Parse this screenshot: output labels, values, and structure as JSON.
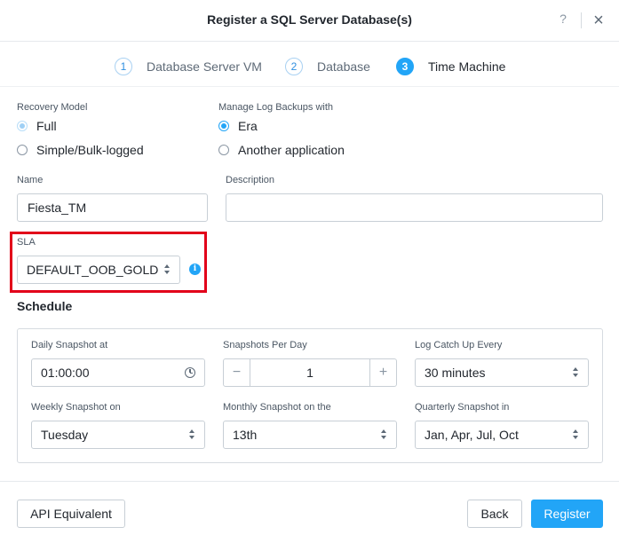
{
  "dialog": {
    "title": "Register a SQL Server Database(s)",
    "help": "?",
    "close": "×"
  },
  "steps": [
    {
      "num": "1",
      "label": "Database Server VM",
      "active": false
    },
    {
      "num": "2",
      "label": "Database",
      "active": false
    },
    {
      "num": "3",
      "label": "Time Machine",
      "active": true
    }
  ],
  "recovery": {
    "label": "Recovery Model",
    "options": [
      {
        "label": "Full",
        "checked": true
      },
      {
        "label": "Simple/Bulk-logged",
        "checked": false
      }
    ]
  },
  "log_backups": {
    "label": "Manage Log Backups with",
    "options": [
      {
        "label": "Era",
        "checked": true
      },
      {
        "label": "Another application",
        "checked": false
      }
    ]
  },
  "name": {
    "label": "Name",
    "value": "Fiesta_TM"
  },
  "description": {
    "label": "Description",
    "value": ""
  },
  "sla": {
    "label": "SLA",
    "value": "DEFAULT_OOB_GOLD_",
    "info": "i"
  },
  "schedule": {
    "title": "Schedule",
    "daily": {
      "label": "Daily Snapshot at",
      "value": "01:00:00"
    },
    "per_day": {
      "label": "Snapshots Per Day",
      "value": "1",
      "minus": "−",
      "plus": "+"
    },
    "catchup": {
      "label": "Log Catch Up Every",
      "value": "30 minutes"
    },
    "weekly": {
      "label": "Weekly Snapshot on",
      "value": "Tuesday"
    },
    "monthly": {
      "label": "Monthly Snapshot on the",
      "value": "13th"
    },
    "quarterly": {
      "label": "Quarterly Snapshot in",
      "value": "Jan, Apr, Jul, Oct"
    }
  },
  "footer": {
    "api": "API Equivalent",
    "back": "Back",
    "register": "Register"
  },
  "colors": {
    "accent": "#22a5f7",
    "highlight": "#e2001a"
  }
}
